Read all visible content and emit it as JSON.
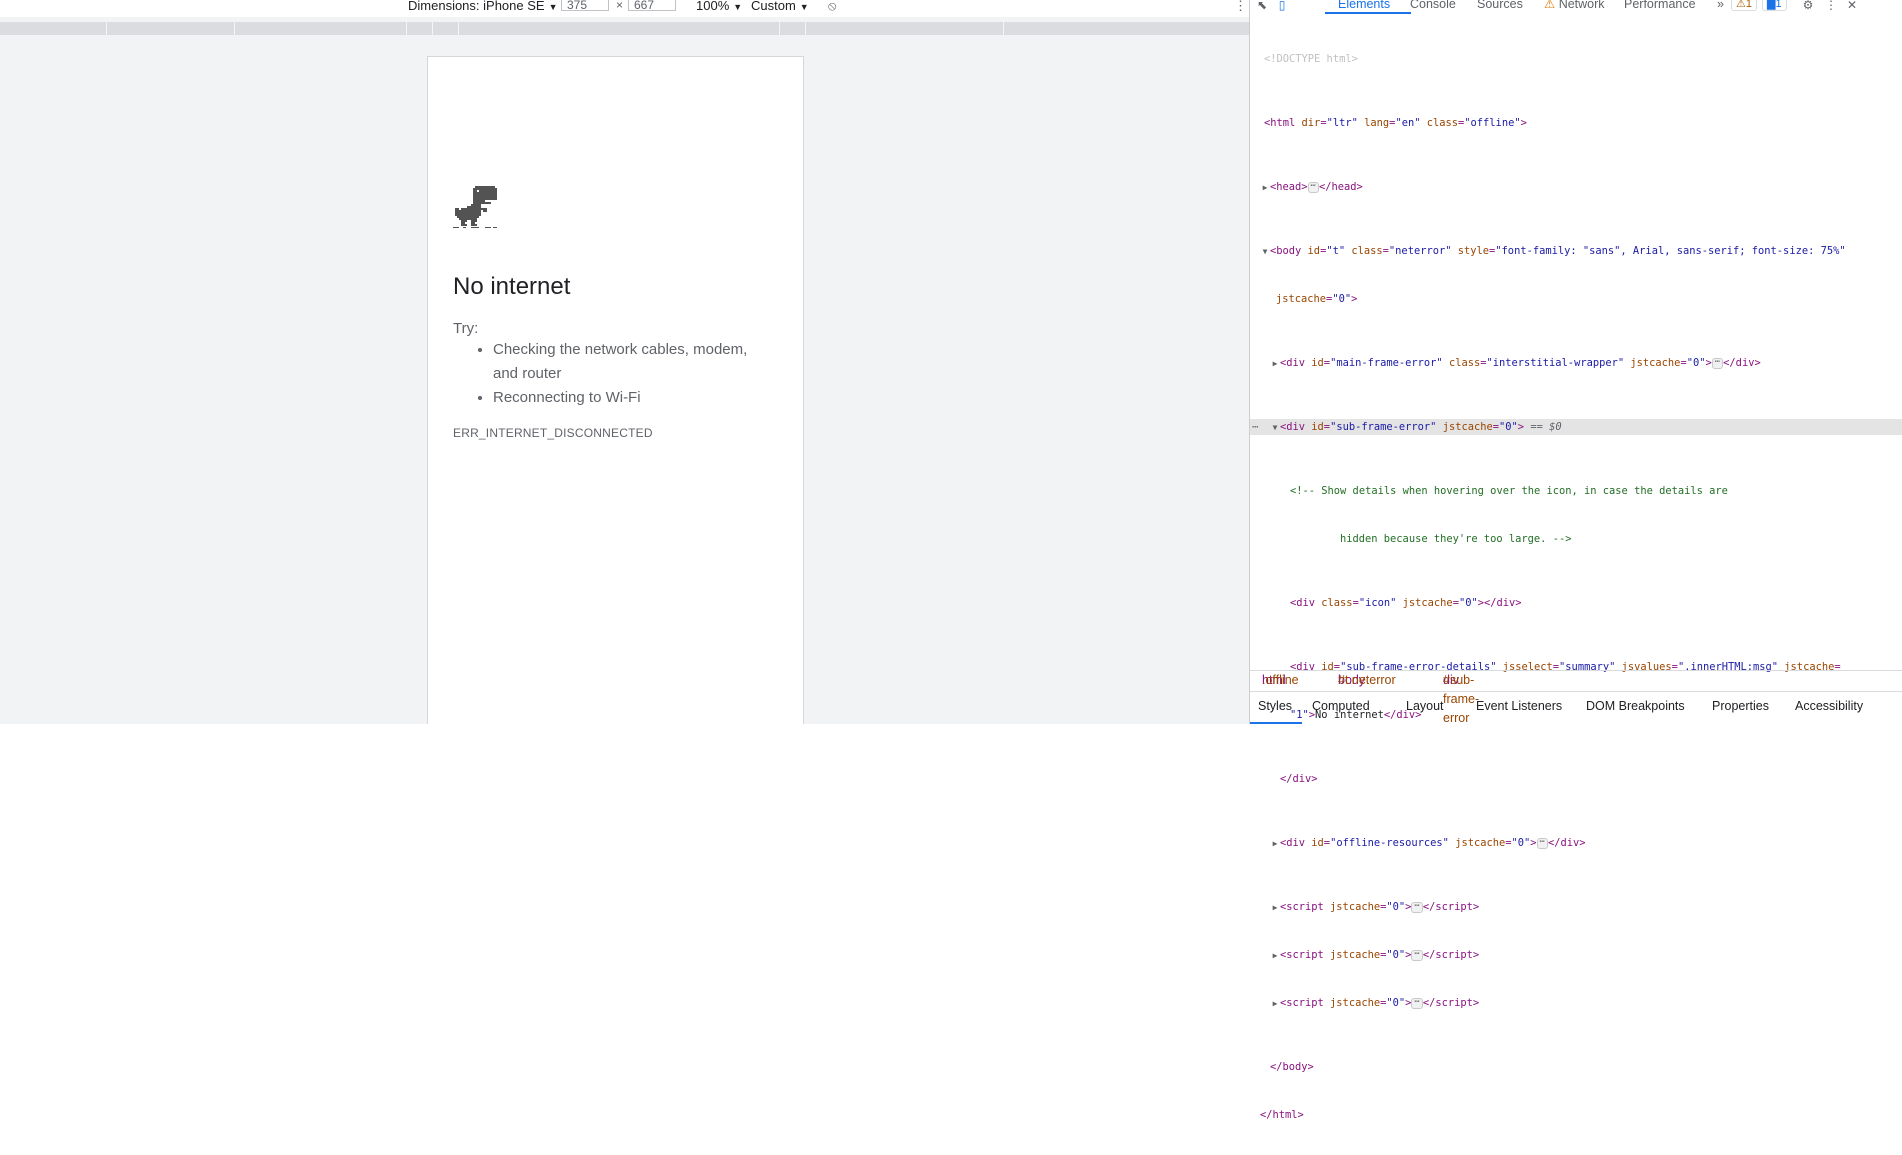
{
  "device_toolbar": {
    "dimensions_label": "Dimensions: iPhone SE",
    "width": "375",
    "times": "×",
    "height": "667",
    "zoom": "100%",
    "throttle": "Custom"
  },
  "page": {
    "title": "No internet",
    "try_label": "Try:",
    "suggestions": [
      "Checking the network cables, modem, and router",
      "Reconnecting to Wi-Fi"
    ],
    "error_code": "ERR_INTERNET_DISCONNECTED"
  },
  "devtools": {
    "tabs": [
      "Elements",
      "Console",
      "Sources",
      "Network",
      "Performance"
    ],
    "more": "»",
    "warning_count": "1",
    "message_count": "1",
    "code": {
      "doctype": "<!DOCTYPE html>",
      "l_html_a": "<html ",
      "l_html_attrs": [
        [
          "dir",
          "\"ltr\""
        ],
        [
          "lang",
          "\"en\""
        ],
        [
          "class",
          "\"offline\""
        ]
      ],
      "head_open": "<head>",
      "head_close": "</head>",
      "body_open": "<body ",
      "body_id": "\"t\"",
      "body_class": "\"neterror\"",
      "body_style": "\"font-family: \"sans\", Arial, sans-serif; font-size: 75%\"",
      "body_jst": "\"0\"",
      "main_frame_id": "\"main-frame-error\"",
      "main_frame_class": "\"interstitial-wrapper\"",
      "main_frame_jst": "\"0\"",
      "sub_frame_id": "\"sub-frame-error\"",
      "sub_frame_jst": "\"0\"",
      "selected_marker": "== $0",
      "comment_1": "<!-- Show details when hovering over the icon, in case the details are",
      "comment_2": "hidden because they're too large. -->",
      "icon_class": "\"icon\"",
      "icon_jst": "\"0\"",
      "details_id": "\"sub-frame-error-details\"",
      "details_jsselect": "\"summary\"",
      "details_jsvalues": "\".innerHTML:msg\"",
      "details_jst": "\"1\"",
      "details_text": "No internet",
      "div_close": "</div>",
      "offline_id": "\"offline-resources\"",
      "offline_jst": "\"0\"",
      "script_jst": "\"0\"",
      "body_close": "</body>",
      "html_close": "</html>"
    },
    "breadcrumbs": [
      {
        "tag": "html",
        "rest": ".offline"
      },
      {
        "tag": "body",
        "rest": "#t.neterror"
      },
      {
        "tag": "div",
        "rest": "#sub-frame-error"
      }
    ],
    "lower_tabs": [
      "Styles",
      "Computed",
      "Layout",
      "Event Listeners",
      "DOM Breakpoints",
      "Properties",
      "Accessibility"
    ]
  }
}
